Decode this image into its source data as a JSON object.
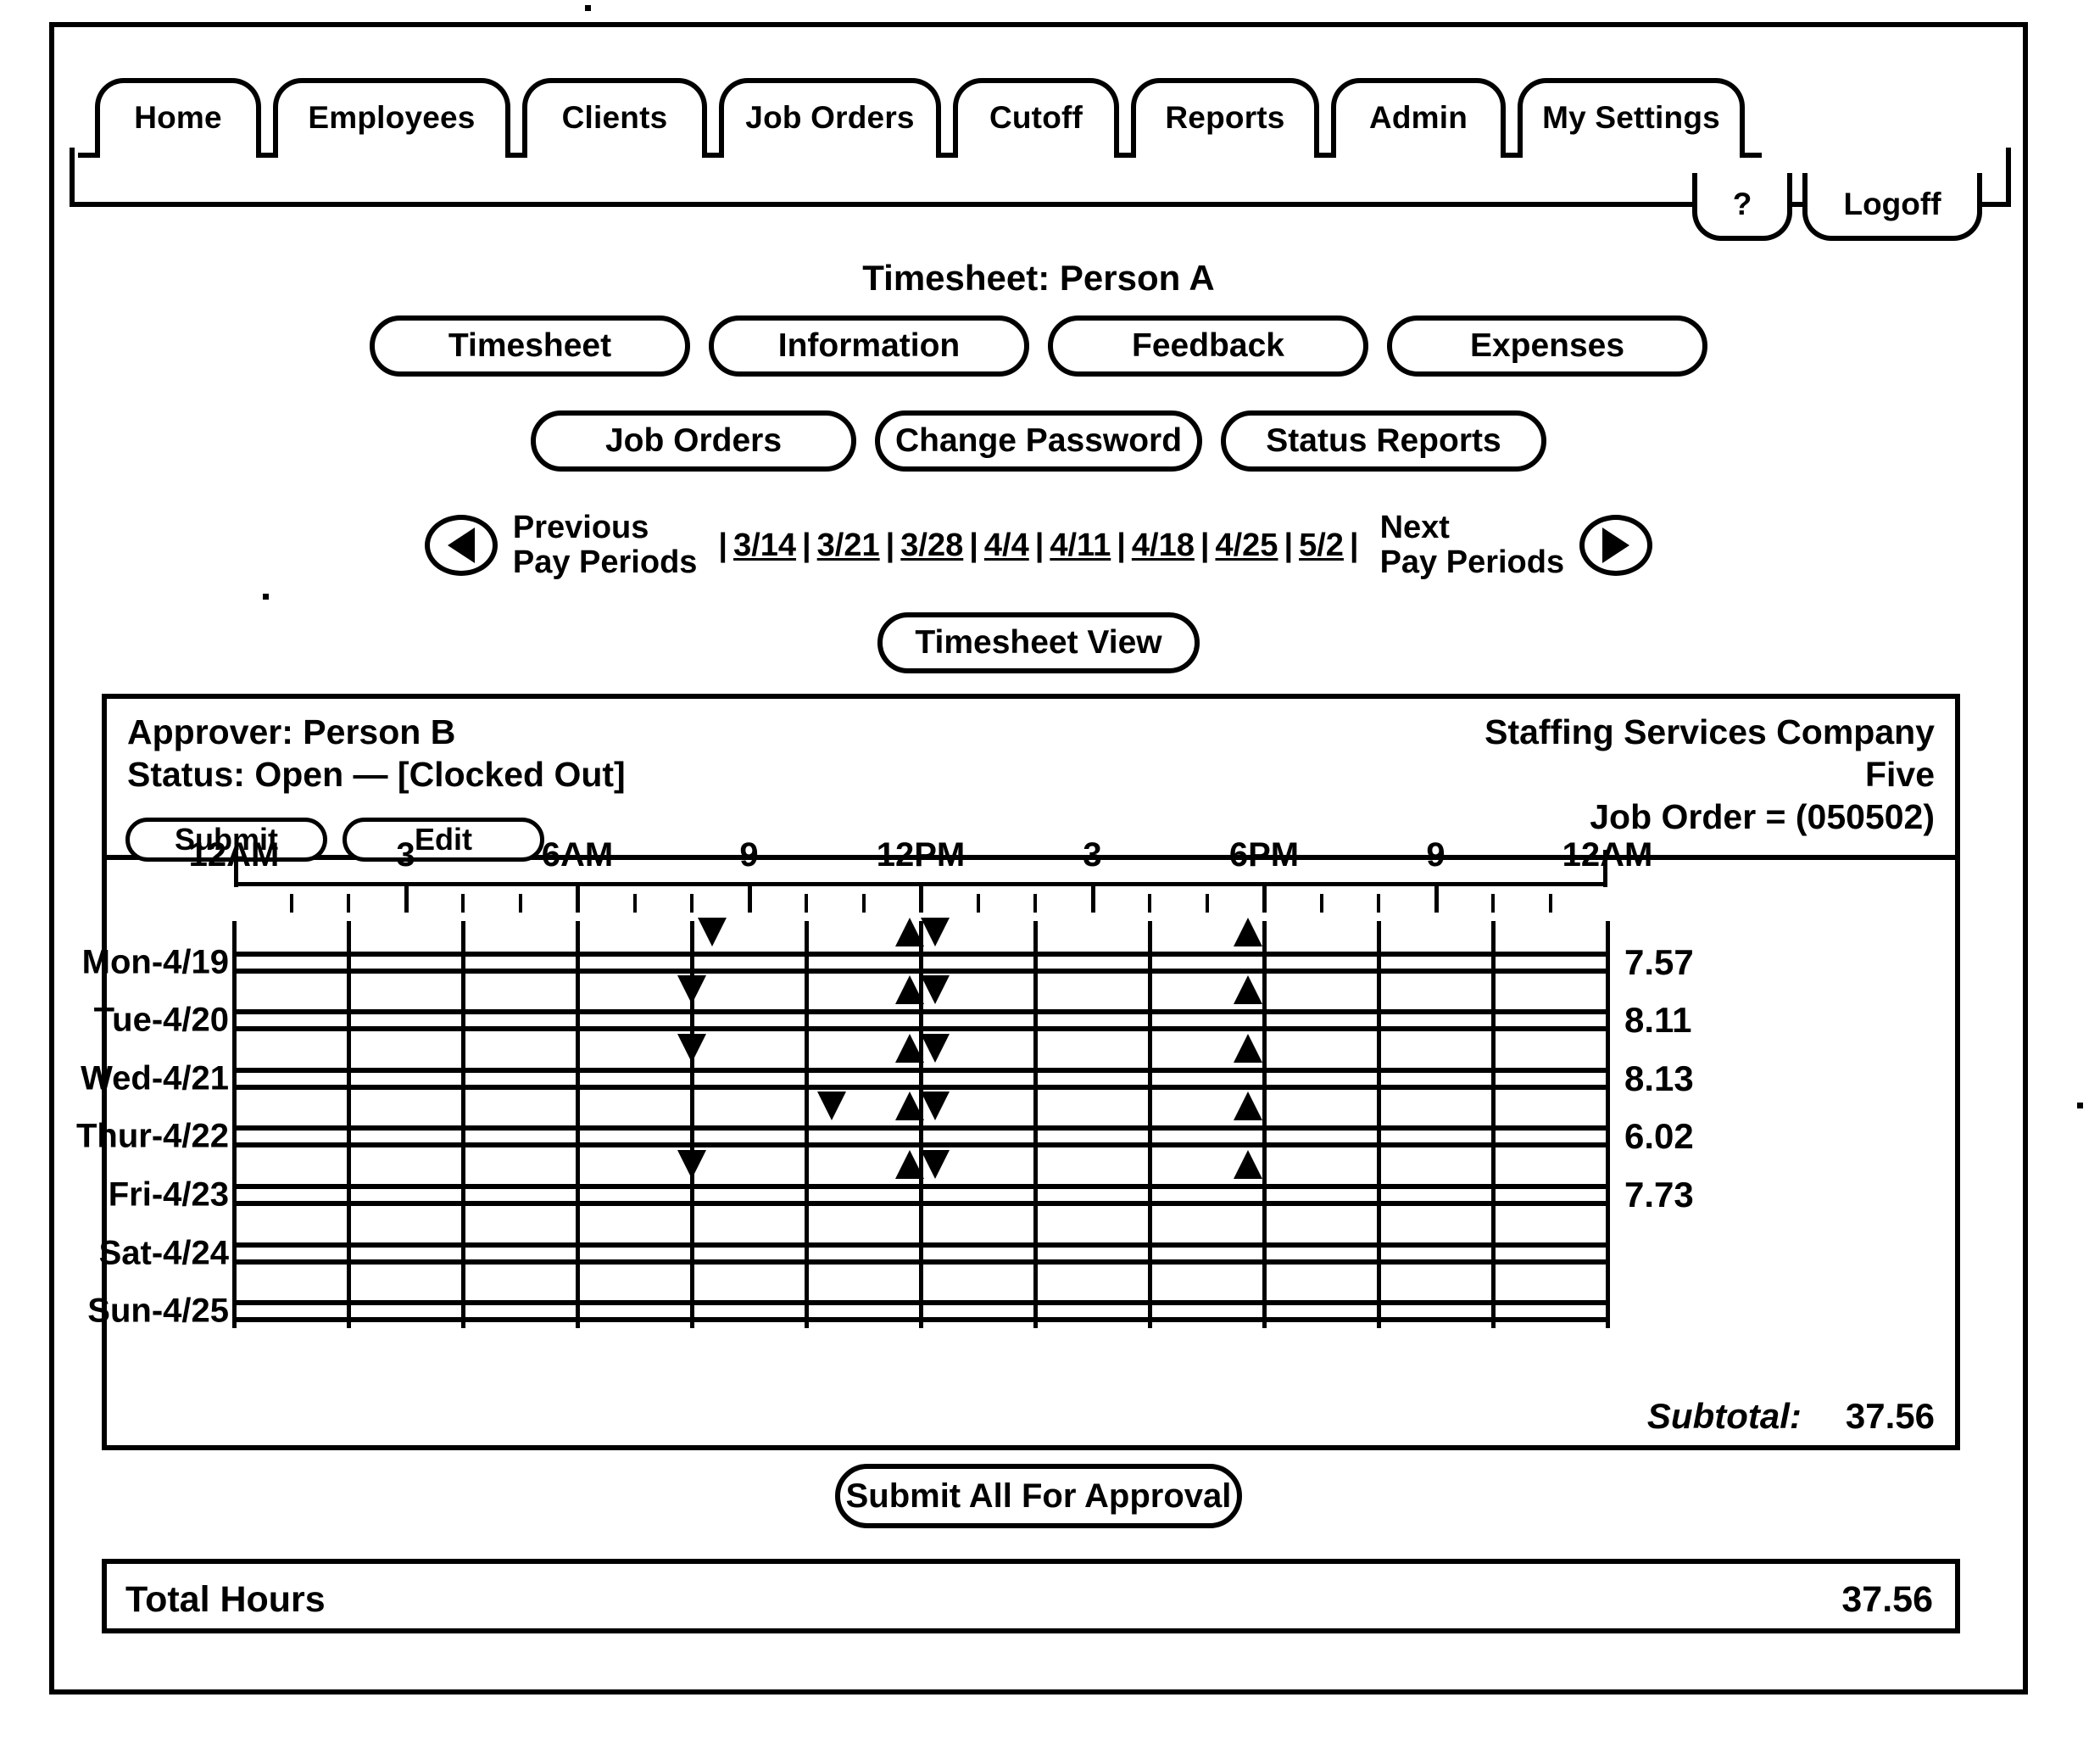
{
  "nav": {
    "tabs": [
      {
        "label": "Home"
      },
      {
        "label": "Employees"
      },
      {
        "label": "Clients"
      },
      {
        "label": "Job Orders"
      },
      {
        "label": "Cutoff"
      },
      {
        "label": "Reports"
      },
      {
        "label": "Admin"
      },
      {
        "label": "My Settings"
      }
    ],
    "help_label": "?",
    "logoff_label": "Logoff"
  },
  "header": {
    "title": "Timesheet: Person A"
  },
  "button_row_1": [
    {
      "label": "Timesheet"
    },
    {
      "label": "Information"
    },
    {
      "label": "Feedback"
    },
    {
      "label": "Expenses"
    }
  ],
  "button_row_2": [
    {
      "label": "Job Orders"
    },
    {
      "label": "Change Password"
    },
    {
      "label": "Status Reports"
    }
  ],
  "pay_nav": {
    "previous_label_line1": "Previous",
    "previous_label_line2": "Pay Periods",
    "next_label_line1": "Next",
    "next_label_line2": "Pay Periods",
    "previous_icon": "triangle-left-icon",
    "next_icon": "triangle-right-icon",
    "periods": [
      "3/14",
      "3/21",
      "3/28",
      "4/4",
      "4/11",
      "4/18",
      "4/25",
      "5/2"
    ],
    "separator": "|"
  },
  "timesheet_view_button": "Timesheet View",
  "panel": {
    "approver_label": "Approver: Person B",
    "status_label": "Status: Open — [Clocked Out]",
    "submit_label": "Submit",
    "edit_label": "Edit",
    "company_line1": "Staffing Services Company",
    "company_line2": "Five",
    "job_order_label": "Job Order = (050502)"
  },
  "subtotal": {
    "label": "Subtotal:",
    "value": "37.56"
  },
  "submit_all_label": "Submit All For Approval",
  "total": {
    "label": "Total Hours",
    "value": "37.56"
  },
  "chart_data": {
    "type": "bar",
    "title": "",
    "xlabel": "",
    "ylabel": "",
    "x_axis": {
      "min_hour": 0,
      "max_hour": 24,
      "major_tick_hours": [
        0,
        3,
        6,
        9,
        12,
        15,
        18,
        21,
        24
      ],
      "tick_labels": [
        "12AM",
        "3",
        "6AM",
        "9",
        "12PM",
        "3",
        "6PM",
        "9",
        "12AM"
      ],
      "minor_tick_interval_hours": 1,
      "grid": true
    },
    "categories": [
      "Mon-4/19",
      "Tue-4/20",
      "Wed-4/21",
      "Thur-4/22",
      "Fri-4/23",
      "Sat-4/24",
      "Sun-4/25"
    ],
    "values": [
      7.57,
      8.11,
      8.13,
      6.02,
      7.73,
      null,
      null
    ],
    "value_labels": [
      "7.57",
      "8.11",
      "8.13",
      "6.02",
      "7.73",
      "",
      ""
    ],
    "rows": [
      {
        "day": "Mon-4/19",
        "hours": "7.57",
        "segments": [
          {
            "start": 8.35,
            "end": 11.8
          },
          {
            "end": 17.72,
            "start": 12.25
          }
        ]
      },
      {
        "day": "Tue-4/20",
        "hours": "8.11",
        "segments": [
          {
            "start": 8.0,
            "end": 11.8
          },
          {
            "start": 12.25,
            "end": 17.72
          }
        ]
      },
      {
        "day": "Wed-4/21",
        "hours": "8.13",
        "segments": [
          {
            "start": 8.0,
            "end": 11.8
          },
          {
            "start": 12.25,
            "end": 17.72
          }
        ]
      },
      {
        "day": "Thur-4/22",
        "hours": "6.02",
        "segments": [
          {
            "start": 10.45,
            "end": 11.8
          },
          {
            "start": 12.25,
            "end": 17.72
          }
        ]
      },
      {
        "day": "Fri-4/23",
        "hours": "7.73",
        "segments": [
          {
            "start": 8.0,
            "end": 11.8
          },
          {
            "start": 12.25,
            "end": 17.72
          }
        ]
      },
      {
        "day": "Sat-4/24",
        "hours": "",
        "segments": []
      },
      {
        "day": "Sun-4/25",
        "hours": "",
        "segments": []
      }
    ],
    "marker_in_icon": "clock-in-down-arrow",
    "marker_out_icon": "clock-out-up-arrow"
  }
}
